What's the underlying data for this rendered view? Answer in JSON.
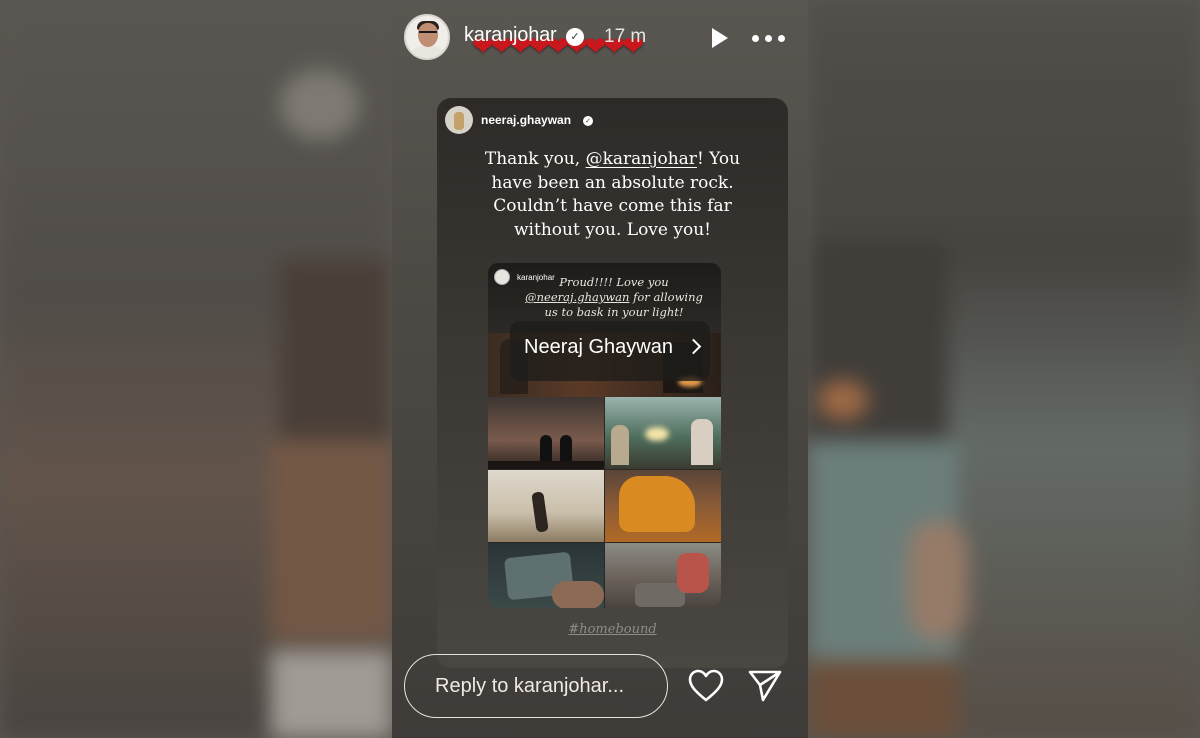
{
  "header": {
    "username": "karanjohar",
    "time": "17 m",
    "hearts": "❤❤❤❤❤❤❤❤❤"
  },
  "reshare": {
    "author": "neeraj.ghaywan",
    "caption_before": "Thank you, ",
    "caption_mention": "@karanjohar",
    "caption_after": "! You have been an absolute rock. Couldn’t have come this far without you. Love you!",
    "inner_post": {
      "author": "karanjohar",
      "caption_line1": "Proud!!!! Love you",
      "caption_mention": "@neeraj.ghaywan",
      "caption_line2": " for allowing",
      "caption_line3": "us to bask in your light!",
      "link_sticker": "Neeraj Ghaywan"
    },
    "hashtag": "#homebound"
  },
  "reply": {
    "placeholder": "Reply to karanjohar..."
  },
  "colors": {
    "heart_red": "#c8181e",
    "text_white": "#ffffff"
  }
}
